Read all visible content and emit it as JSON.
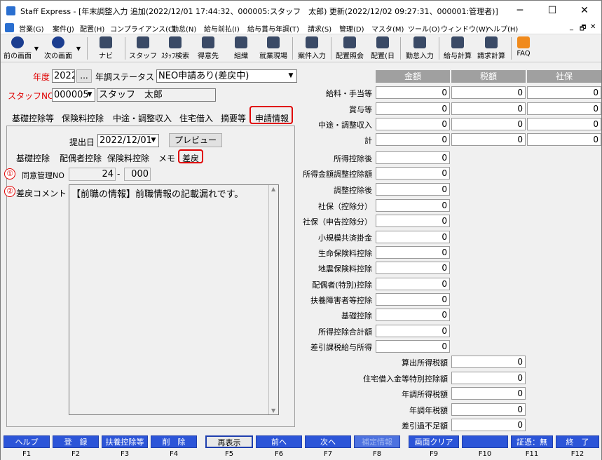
{
  "window": {
    "title": "Staff Express - [年末調整入力 追加(2022/12/01 17:44:32、000005:スタッフ　太郎) 更新(2022/12/02 09:27:31、000001:管理者)]",
    "controls": {
      "minimize": "─",
      "maximize": "☐",
      "close": "✕"
    },
    "mdi_controls": {
      "minimize": "_",
      "restore": "🗗",
      "close": "✕"
    }
  },
  "menu": [
    "営業(G)",
    "案件(J)",
    "配置(H)",
    "コンプライアンス(C)",
    "勤怠(N)",
    "給与前払(I)",
    "給与賞与年調(T)",
    "請求(S)",
    "管理(D)",
    "マスタ(M)",
    "ツール(O)",
    "ウィンドウ(W)",
    "ヘルプ(H)"
  ],
  "toolbar": [
    "前の画面",
    "次の画面",
    "ナビ",
    "スタッフ",
    "ｽﾀｯﾌ検索",
    "得意先",
    "組織",
    "就業現場",
    "案件入力",
    "配置照会",
    "配置(日",
    "勤怠入力",
    "給与計算",
    "請求計算",
    "FAQ"
  ],
  "form": {
    "year_label": "年度",
    "year_value": "2022",
    "year_btn": "...",
    "status_label": "年調ステータス",
    "status_value": "NEO申請あり(差戻中)",
    "staff_label": "スタッフNO",
    "staff_no": "000005",
    "staff_name": "スタッフ　太郎"
  },
  "tabs": [
    "基礎控除等",
    "保険料控除",
    "中途・調整収入",
    "住宅借入",
    "摘要等",
    "申請情報"
  ],
  "apply": {
    "submit_label": "提出日",
    "submit_date": "2022/12/01",
    "preview_btn": "プレビュー",
    "subtabs": [
      "基礎控除",
      "配偶者控除",
      "保険料控除",
      "メモ",
      "差戻"
    ],
    "consent_label": "同意管理NO",
    "consent_no1": "24",
    "consent_dash": "-",
    "consent_no2": "000",
    "comment_label": "差戻コメント",
    "comment_text": "【前職の情報】前職情報の記載漏れです。",
    "marker1": "①",
    "marker2": "②"
  },
  "grid": {
    "headers": [
      "金額",
      "税額",
      "社保"
    ],
    "rows": [
      {
        "label": "給料・手当等",
        "values": [
          "0",
          "0",
          "0"
        ]
      },
      {
        "label": "賞与等",
        "values": [
          "0",
          "0",
          "0"
        ]
      },
      {
        "label": "中途・調整収入",
        "values": [
          "0",
          "0",
          "0"
        ]
      },
      {
        "label": "計",
        "values": [
          "0",
          "0",
          "0"
        ]
      }
    ],
    "deductions": [
      {
        "label": "所得控除後",
        "value": "0"
      },
      {
        "label": "所得金額調整控除額",
        "value": "0"
      },
      {
        "label": "調整控除後",
        "value": "0"
      },
      {
        "label": "社保（控除分）",
        "value": "0"
      },
      {
        "label": "社保（申告控除分）",
        "value": "0"
      },
      {
        "label": "小規模共済掛金",
        "value": "0"
      },
      {
        "label": "生命保険料控除",
        "value": "0"
      },
      {
        "label": "地震保険料控除",
        "value": "0"
      },
      {
        "label": "配偶者(特別)控除",
        "value": "0"
      },
      {
        "label": "扶養障害者等控除",
        "value": "0"
      },
      {
        "label": "基礎控除",
        "value": "0"
      },
      {
        "label": "所得控除合計額",
        "value": "0"
      },
      {
        "label": "差引課税給与所得",
        "value": "0"
      }
    ],
    "taxes": [
      {
        "label": "算出所得税額",
        "value": "0"
      },
      {
        "label": "住宅借入金等特別控除額",
        "value": "0"
      },
      {
        "label": "年調所得税額",
        "value": "0"
      },
      {
        "label": "年調年税額",
        "value": "0"
      },
      {
        "label": "差引過不足額",
        "value": "0"
      }
    ]
  },
  "fkeys": [
    {
      "label": "ヘルプ",
      "key": "F1"
    },
    {
      "label": "登　録",
      "key": "F2"
    },
    {
      "label": "扶養控除等",
      "key": "F3"
    },
    {
      "label": "削　除",
      "key": "F4"
    },
    {
      "label": "再表示",
      "key": "F5"
    },
    {
      "label": "前へ",
      "key": "F6"
    },
    {
      "label": "次へ",
      "key": "F7"
    },
    {
      "label": "補定情報",
      "key": "F8"
    },
    {
      "label": "画面クリア",
      "key": "F9"
    },
    {
      "label": "",
      "key": "F10"
    },
    {
      "label": "証憑：無",
      "key": "F11"
    },
    {
      "label": "終　了",
      "key": "F12"
    }
  ]
}
